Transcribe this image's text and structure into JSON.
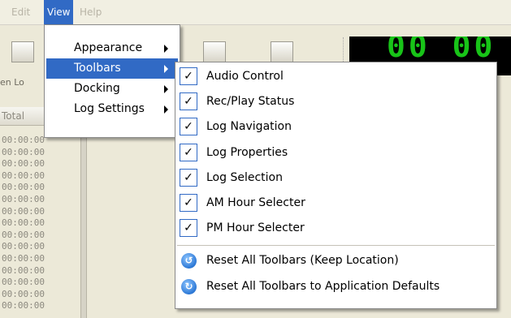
{
  "menubar": {
    "items": [
      {
        "label": "Edit"
      },
      {
        "label": "View"
      },
      {
        "label": "Help"
      }
    ]
  },
  "toolbar": {
    "open_label": "en Lo",
    "display_digits": "00 00"
  },
  "log_pane": {
    "column_header": "Total",
    "times": [
      "00:00:00",
      "00:00:00",
      "00:00:00",
      "00:00:00",
      "00:00:00",
      "00:00:00",
      "00:00:00",
      "00:00:00",
      "00:00:00",
      "00:00:00",
      "00:00:00",
      "00:00:00",
      "00:00:00",
      "00:00:00",
      "00:00:00"
    ]
  },
  "view_menu": {
    "items": [
      {
        "label": "Appearance",
        "has_submenu": true
      },
      {
        "label": "Toolbars",
        "has_submenu": true,
        "selected": true
      },
      {
        "label": "Docking",
        "has_submenu": true
      },
      {
        "label": "Log Settings",
        "has_submenu": true
      }
    ]
  },
  "toolbars_submenu": {
    "checked_items": [
      {
        "label": "Audio Control",
        "checked": true
      },
      {
        "label": "Rec/Play Status",
        "checked": true
      },
      {
        "label": "Log Navigation",
        "checked": true
      },
      {
        "label": "Log Properties",
        "checked": true
      },
      {
        "label": "Log Selection",
        "checked": true
      },
      {
        "label": "AM Hour Selecter",
        "checked": true
      },
      {
        "label": "PM Hour Selecter",
        "checked": true
      }
    ],
    "reset_items": [
      {
        "label": "Reset All Toolbars (Keep Location)"
      },
      {
        "label": "Reset All Toolbars to Application Defaults"
      }
    ]
  },
  "colors": {
    "highlight": "#316ac5",
    "display_digits": "#18c418"
  }
}
